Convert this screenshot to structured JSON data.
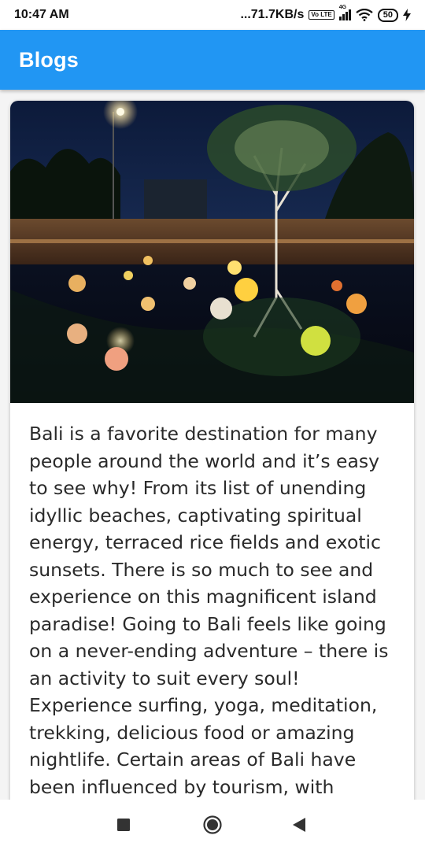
{
  "status_bar": {
    "time": "10:47 AM",
    "network_speed": "...71.7KB/s",
    "volte_label": "Vo LTE",
    "signal_label": "4G",
    "battery_level": "50",
    "icons": [
      "volte-icon",
      "signal-icon",
      "wifi-icon",
      "battery-icon",
      "charging-icon"
    ]
  },
  "app_bar": {
    "title": "Blogs",
    "color": "#2196f3"
  },
  "blog_card": {
    "image_description_icon": "photo",
    "text": "Bali is a favorite destination for many people around the world and it’s easy to see why! From its list of unending idyllic beaches, captivating spiritual energy, terraced rice fields and exotic sunsets. There is so much to see and experience on this magnificent island paradise! Going to Bali feels like going on a never-ending adventure – there is an activity to suit every soul! Experience surfing, yoga, meditation, trekking, delicious food or amazing nightlife. Certain areas of Bali have been influenced by tourism, with"
  },
  "nav_bar": {
    "buttons": [
      "recents-button",
      "home-button",
      "back-button"
    ]
  }
}
